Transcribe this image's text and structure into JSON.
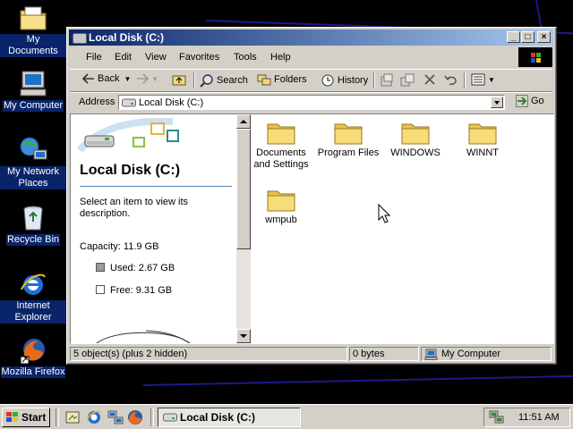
{
  "desktop": {
    "icons": [
      {
        "label": "My Documents",
        "icon": "my-documents-icon"
      },
      {
        "label": "My Computer",
        "icon": "my-computer-icon"
      },
      {
        "label": "My Network Places",
        "icon": "network-places-icon"
      },
      {
        "label": "Recycle Bin",
        "icon": "recycle-bin-icon"
      },
      {
        "label": "Internet Explorer",
        "icon": "internet-explorer-icon"
      },
      {
        "label": "Mozilla Firefox",
        "icon": "firefox-icon"
      }
    ]
  },
  "window": {
    "title": "Local Disk (C:)",
    "menu": [
      "File",
      "Edit",
      "View",
      "Favorites",
      "Tools",
      "Help"
    ],
    "toolbar": {
      "back": "Back",
      "search": "Search",
      "folders": "Folders",
      "history": "History"
    },
    "address": {
      "label": "Address",
      "value": "Local Disk (C:)",
      "go": "Go"
    },
    "left_pane": {
      "title": "Local Disk (C:)",
      "hint": "Select an item to view its description.",
      "capacity": "Capacity: 11.9 GB",
      "used": "Used: 2.67 GB",
      "free": "Free: 9.31 GB"
    },
    "folders": [
      "Documents and Settings",
      "Program Files",
      "WINDOWS",
      "WINNT",
      "wmpub"
    ],
    "status": {
      "objects": "5 object(s) (plus 2 hidden)",
      "size": "0 bytes",
      "location": "My Computer"
    }
  },
  "taskbar": {
    "start": "Start",
    "task": "Local Disk (C:)",
    "clock": "11:51 AM"
  },
  "colors": {
    "title_active": "#0a246a",
    "title_gradient_end": "#a6caf0",
    "folder": "#f3d66f",
    "face": "#d4d0c8"
  }
}
